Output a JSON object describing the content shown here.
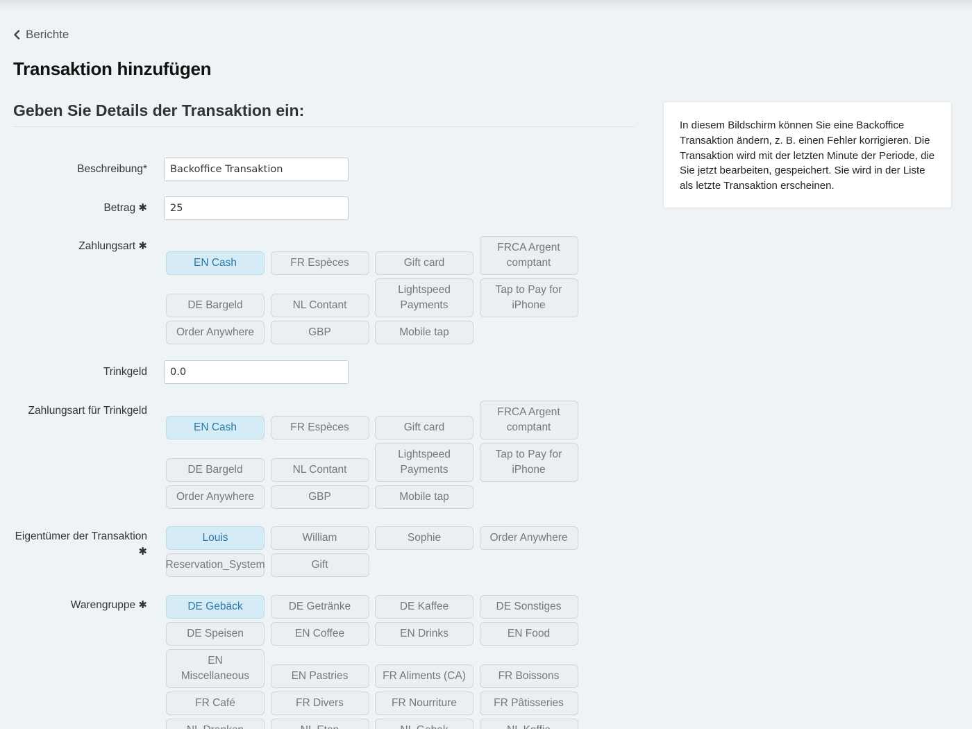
{
  "nav": {
    "back_label": "Berichte"
  },
  "page": {
    "title": "Transaktion hinzufügen",
    "section_title": "Geben Sie Details der Transaktion ein:"
  },
  "fields": {
    "description": {
      "label": "Beschreibung*",
      "value": "Backoffice Transaktion"
    },
    "amount": {
      "label": "Betrag",
      "value": "25"
    },
    "payment_type": {
      "label": "Zahlungsart",
      "selected": "EN Cash",
      "options": [
        "EN Cash",
        "FR Espèces",
        "Gift card",
        "FRCA Argent comptant",
        "DE Bargeld",
        "NL Contant",
        "Lightspeed Payments",
        "Tap to Pay for iPhone",
        "Order Anywhere",
        "GBP",
        "Mobile tap"
      ]
    },
    "tip": {
      "label": "Trinkgeld",
      "value": "0.0"
    },
    "tip_payment_type": {
      "label": "Zahlungsart für Trinkgeld",
      "selected": "EN Cash",
      "options": [
        "EN Cash",
        "FR Espèces",
        "Gift card",
        "FRCA Argent comptant",
        "DE Bargeld",
        "NL Contant",
        "Lightspeed Payments",
        "Tap to Pay for iPhone",
        "Order Anywhere",
        "GBP",
        "Mobile tap"
      ]
    },
    "owner": {
      "label": "Eigentümer der Transaktion",
      "selected": "Louis",
      "options": [
        "Louis",
        "William",
        "Sophie",
        "Order Anywhere",
        "Reservation_System",
        "Gift"
      ]
    },
    "product_group": {
      "label": "Warengruppe",
      "selected": "DE Gebäck",
      "options": [
        "DE Gebäck",
        "DE Getränke",
        "DE Kaffee",
        "DE Sonstiges",
        "DE Speisen",
        "EN Coffee",
        "EN Drinks",
        "EN Food",
        "EN Miscellaneous",
        "EN Pastries",
        "FR Aliments (CA)",
        "FR Boissons",
        "FR Café",
        "FR Divers",
        "FR Nourriture",
        "FR Pâtisseries",
        "NL Dranken",
        "NL Eten",
        "NL Gebak",
        "NL Koffie"
      ]
    }
  },
  "help_text": "In diesem Bildschirm können Sie eine Backoffice Transaktion ändern, z. B. einen Fehler korrigieren. Die Transaktion wird mit der letzten Minute der Periode, die Sie jetzt bearbeiten, gespeichert. Sie wird in der Liste als letzte Transaktion erscheinen.",
  "required_marker": "✱",
  "colors": {
    "background": "#eef3f6",
    "chip_bg": "#eaeff1",
    "chip_active_bg": "#d5ebf6",
    "chip_active_text": "#2a78a8"
  },
  "icons": {
    "back": "chevron-left-icon"
  }
}
